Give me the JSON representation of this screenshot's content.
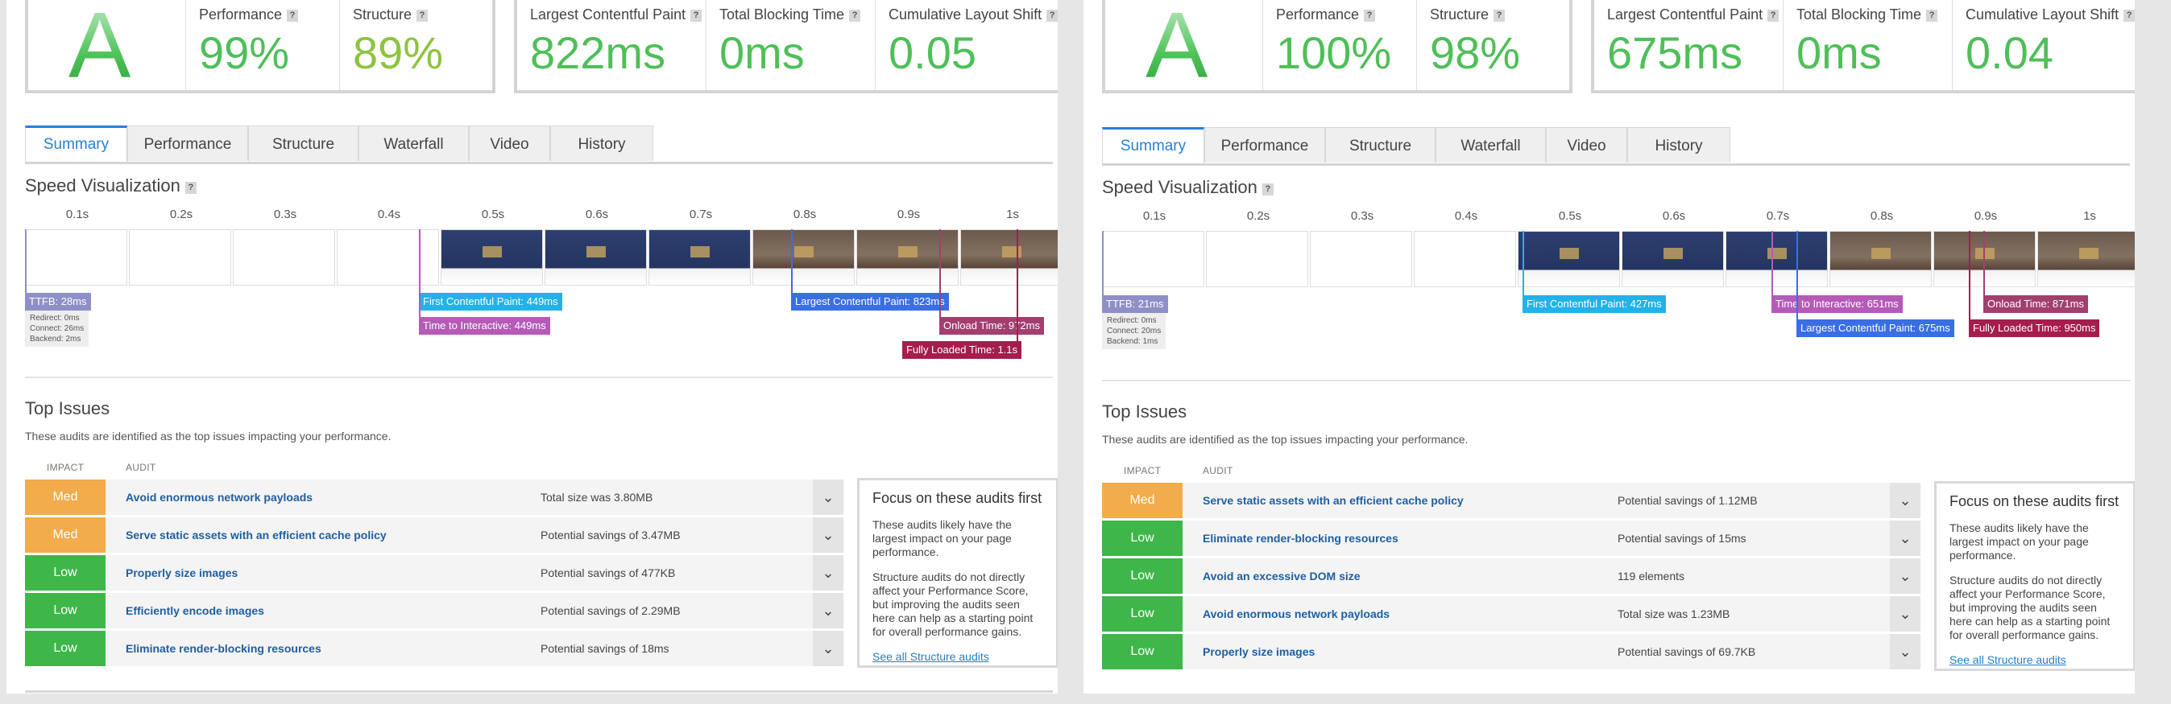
{
  "colors": {
    "accent": "#2a7fd4",
    "grade_green": "#4fbf58",
    "impact_med": "#f2ac4b",
    "impact_low": "#3eb649",
    "ttfb": "#8f8fc8",
    "fcp": "#22b2e7",
    "tti": "#b65ab8",
    "lcp": "#3a6ee3",
    "onload": "#a23f6f",
    "fully_loaded": "#a51d4d"
  },
  "shared": {
    "tabs": [
      "Summary",
      "Performance",
      "Structure",
      "Waterfall",
      "Video",
      "History"
    ],
    "speed_title": "Speed Visualization",
    "ticks": [
      "0.1s",
      "0.2s",
      "0.3s",
      "0.4s",
      "0.5s",
      "0.6s",
      "0.7s",
      "0.8s",
      "0.9s",
      "1s"
    ],
    "top_issues_title": "Top Issues",
    "top_issues_desc": "These audits are identified as the top issues impacting your performance.",
    "col_impact": "IMPACT",
    "col_audit": "AUDIT",
    "metric_labels": {
      "performance": "Performance",
      "structure": "Structure",
      "lcp": "Largest Contentful Paint",
      "tbt": "Total Blocking Time",
      "cls": "Cumulative Layout Shift"
    },
    "help_glyph": "?",
    "chevron": "⌄",
    "focus": {
      "title": "Focus on these audits first",
      "p1": "These audits likely have the largest impact on your page performance.",
      "p2": "Structure audits do not directly affect your Performance Score, but improving the audits seen here can help as a starting point for overall performance gains.",
      "link": "See all Structure audits"
    }
  },
  "reports": [
    {
      "grade": "A",
      "performance": "99%",
      "structure": "89%",
      "lcp": "822ms",
      "tbt": "0ms",
      "cls": "0.05",
      "markers": {
        "ttfb": "TTFB: 28ms",
        "ttfb_info": [
          "Redirect: 0ms",
          "Connect: 26ms",
          "Backend: 2ms"
        ],
        "fcp": "First Contentful Paint: 449ms",
        "tti": "Time to Interactive: 449ms",
        "lcp": "Largest Contentful Paint: 823ms",
        "onload": "Onload Time: 972ms",
        "fully_loaded": "Fully Loaded Time: 1.1s"
      },
      "issues": [
        {
          "impact": "Med",
          "audit": "Avoid enormous network payloads",
          "detail": "Total size was 3.80MB"
        },
        {
          "impact": "Med",
          "audit": "Serve static assets with an efficient cache policy",
          "detail": "Potential savings of 3.47MB"
        },
        {
          "impact": "Low",
          "audit": "Properly size images",
          "detail": "Potential savings of 477KB"
        },
        {
          "impact": "Low",
          "audit": "Efficiently encode images",
          "detail": "Potential savings of 2.29MB"
        },
        {
          "impact": "Low",
          "audit": "Eliminate render-blocking resources",
          "detail": "Potential savings of 18ms"
        }
      ]
    },
    {
      "grade": "A",
      "performance": "100%",
      "structure": "98%",
      "lcp": "675ms",
      "tbt": "0ms",
      "cls": "0.04",
      "markers": {
        "ttfb": "TTFB: 21ms",
        "ttfb_info": [
          "Redirect: 0ms",
          "Connect: 20ms",
          "Backend: 1ms"
        ],
        "fcp": "First Contentful Paint: 427ms",
        "tti": "Time to Interactive: 651ms",
        "lcp": "Largest Contentful Paint: 675ms",
        "onload": "Onload Time: 871ms",
        "fully_loaded": "Fully Loaded Time: 950ms"
      },
      "issues": [
        {
          "impact": "Med",
          "audit": "Serve static assets with an efficient cache policy",
          "detail": "Potential savings of 1.12MB"
        },
        {
          "impact": "Low",
          "audit": "Eliminate render-blocking resources",
          "detail": "Potential savings of 15ms"
        },
        {
          "impact": "Low",
          "audit": "Avoid an excessive DOM size",
          "detail": "119 elements"
        },
        {
          "impact": "Low",
          "audit": "Avoid enormous network payloads",
          "detail": "Total size was 1.23MB"
        },
        {
          "impact": "Low",
          "audit": "Properly size images",
          "detail": "Potential savings of 69.7KB"
        }
      ]
    }
  ]
}
